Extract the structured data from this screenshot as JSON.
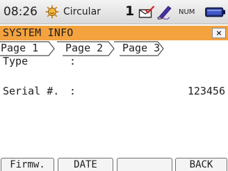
{
  "status_bar": {
    "time": "08:26",
    "mode": "Circular",
    "number": "1",
    "keyboard": "NUM",
    "icons": [
      "sun-icon",
      "mail-check-icon",
      "signature-pen-icon",
      "battery-icon"
    ]
  },
  "window": {
    "title": "SYSTEM INFO",
    "close_label": "×",
    "title_bar_color": "#f3a23e"
  },
  "tabs": [
    {
      "label": "Page 1",
      "active": true
    },
    {
      "label": "Page 2",
      "active": false
    },
    {
      "label": "Page 3",
      "active": false
    }
  ],
  "content": {
    "type": {
      "label": "Type",
      "separator": ":",
      "value": ""
    },
    "serial": {
      "label": "Serial #.",
      "separator": ":",
      "value": "123456"
    }
  },
  "softkeys": [
    {
      "label": "Firmw."
    },
    {
      "label": "DATE"
    },
    {
      "label": ""
    },
    {
      "label": "BACK"
    }
  ]
}
